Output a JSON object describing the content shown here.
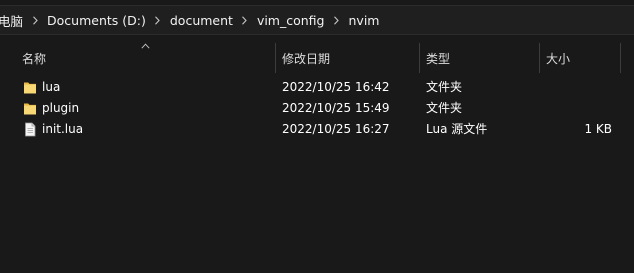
{
  "breadcrumb": {
    "items": [
      "电脑",
      "Documents (D:)",
      "document",
      "vim_config",
      "nvim"
    ]
  },
  "columns": {
    "name": "名称",
    "date": "修改日期",
    "type": "类型",
    "size": "大小"
  },
  "files": [
    {
      "name": "lua",
      "date": "2022/10/25 16:42",
      "type": "文件夹",
      "size": "",
      "icon": "folder-icon"
    },
    {
      "name": "plugin",
      "date": "2022/10/25 15:49",
      "type": "文件夹",
      "size": "",
      "icon": "folder-icon"
    },
    {
      "name": "init.lua",
      "date": "2022/10/25 16:27",
      "type": "Lua 源文件",
      "size": "1 KB",
      "icon": "file-icon"
    }
  ],
  "colors": {
    "background": "#191919",
    "folder": "#f8d775",
    "text": "#ffffff"
  }
}
